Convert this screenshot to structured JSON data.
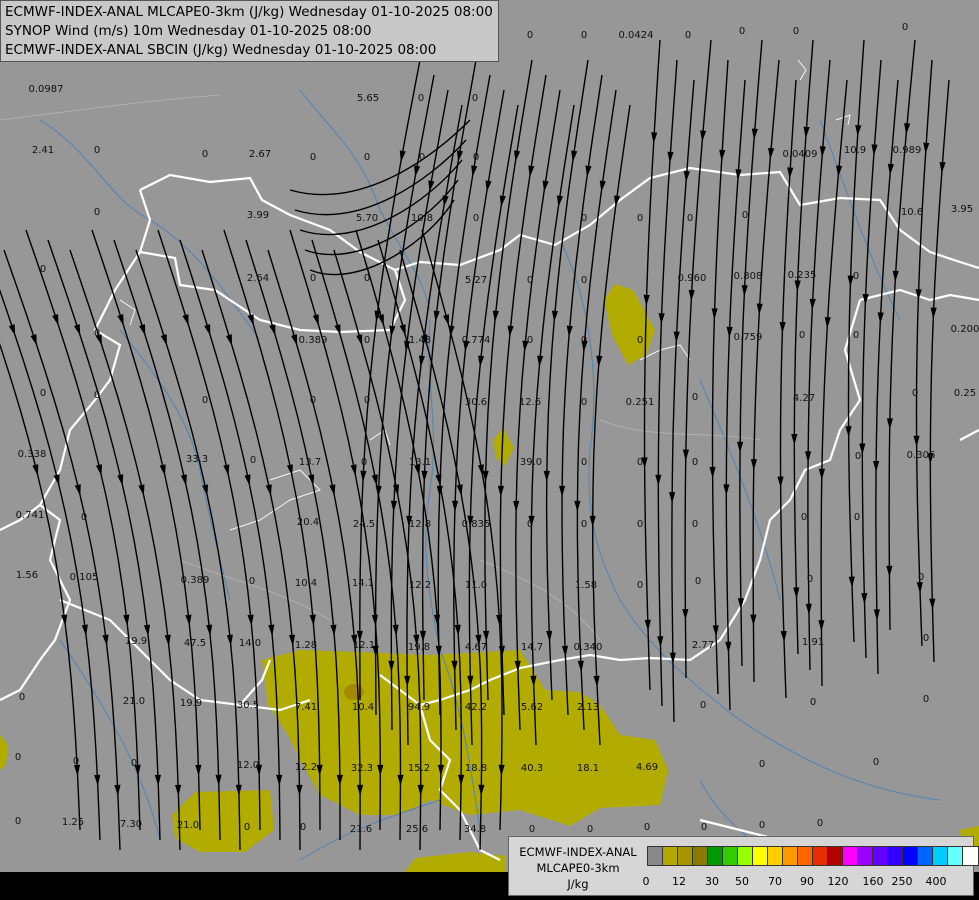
{
  "header": {
    "lines": [
      "ECMWF-INDEX-ANAL MLCAPE0-3km (J/kg) Wednesday 01-10-2025 08:00",
      "SYNOP Wind (m/s) 10m Wednesday 01-10-2025 08:00",
      "ECMWF-INDEX-ANAL SBCIN (J/kg) Wednesday 01-10-2025 08:00"
    ]
  },
  "legend": {
    "title_line1": "ECMWF-INDEX-ANAL",
    "title_line2": "MLCAPE0-3km",
    "unit": "J/kg",
    "colors": [
      "#8a8a8a",
      "#b5a800",
      "#a89500",
      "#8c7a00",
      "#009900",
      "#33cc00",
      "#99ff00",
      "#ffff00",
      "#ffcc00",
      "#ff9900",
      "#ff6600",
      "#e62e00",
      "#b30000",
      "#ff00ff",
      "#9900ff",
      "#6600ff",
      "#3300ff",
      "#0000ff",
      "#0066ff",
      "#00ccff",
      "#66ffff",
      "#ffffff"
    ],
    "ticks": [
      "0",
      "12",
      "30",
      "50",
      "70",
      "90",
      "120",
      "160",
      "250",
      "400"
    ]
  },
  "colors": {
    "background": "#979797",
    "cape_fill": "#b3ac00",
    "border": "#ffffff",
    "river": "#5b86b3",
    "streamline": "#000000"
  },
  "values": [
    "0.0987",
    "5.65",
    "0",
    "0",
    "0",
    "0",
    "0.0424",
    "0",
    "0",
    "0",
    "0",
    "2.41",
    "0",
    "0",
    "2.67",
    "0",
    "0",
    "0",
    "0",
    "0.0409",
    "10.9",
    "0.989",
    "0",
    "3.99",
    "5.70",
    "10.8",
    "0",
    "0",
    "0",
    "0",
    "0",
    "10.6",
    "3.95",
    "0",
    "2.64",
    "0",
    "0",
    "5.27",
    "0",
    "0",
    "0.960",
    "0.808",
    "0.235",
    "0",
    "0",
    "0.389",
    "0",
    "1.48",
    "0.774",
    "0",
    "0",
    "0",
    "0.759",
    "0",
    "0",
    "0.200",
    "0",
    "0",
    "0",
    "0",
    "0",
    "30.6",
    "12.6",
    "0",
    "0.251",
    "0",
    "4.27",
    "0",
    "0.25",
    "0.338",
    "33.3",
    "0",
    "13.7",
    "0",
    "13.1",
    "39.0",
    "0",
    "0",
    "0",
    "0",
    "0.306",
    "0.741",
    "0",
    "20.4",
    "24.5",
    "12.8",
    "0.835",
    "0",
    "0",
    "0",
    "0",
    "0",
    "0",
    "1.56",
    "0.105",
    "0.389",
    "0",
    "10.4",
    "14.1",
    "12.2",
    "11.0",
    "1.58",
    "0",
    "0",
    "0",
    "0",
    "19.9",
    "47.5",
    "14.0",
    "1.28",
    "12.1",
    "19.8",
    "4.67",
    "14.7",
    "0.340",
    "2.77",
    "1.91",
    "0",
    "0",
    "21.0",
    "19.9",
    "30.5",
    "7.41",
    "10.4",
    "94.9",
    "42.2",
    "5.62",
    "2.13",
    "0",
    "0",
    "0",
    "0",
    "0",
    "0",
    "12.0",
    "12.2",
    "32.3",
    "15.2",
    "18.8",
    "40.3",
    "18.1",
    "4.69",
    "0",
    "0",
    "0",
    "1.25",
    "7.30",
    "21.0",
    "0",
    "0",
    "21.6",
    "25.6",
    "34.8",
    "0",
    "0",
    "0",
    "0",
    "0",
    "0",
    "0"
  ]
}
